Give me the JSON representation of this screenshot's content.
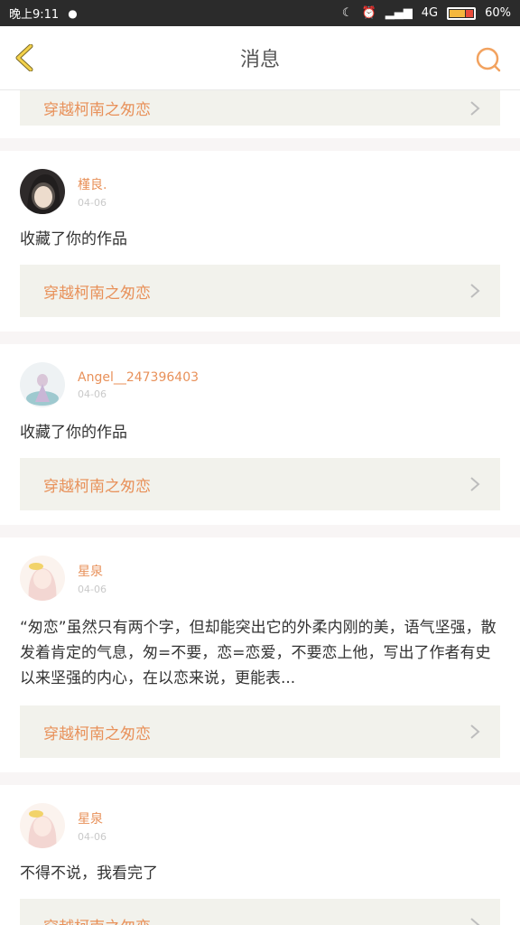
{
  "status": {
    "time": "晚上9:11",
    "network": "4G",
    "battery": "60%"
  },
  "header": {
    "title": "消息"
  },
  "link_text": "穿越柯南之匆恋",
  "messages": [
    {
      "user": "槿良.",
      "date": "04-06",
      "text": "收藏了你的作品"
    },
    {
      "user": "Angel__247396403",
      "date": "04-06",
      "text": "收藏了你的作品"
    },
    {
      "user": "星泉",
      "date": "04-06",
      "text": "“匆恋”虽然只有两个字，但却能突出它的外柔内刚的美，语气坚强，散发着肯定的气息，匆=不要，恋=恋爱，不要恋上他，写出了作者有史以来坚强的内心，在以恋来说，更能表..."
    },
    {
      "user": "星泉",
      "date": "04-06",
      "text": "不得不说，我看完了"
    }
  ],
  "colors": {
    "accent": "#e8915a",
    "card_bg": "#f2f2ec",
    "divider_bg": "#f8f5f5"
  },
  "icons": {
    "back": "chevron-left-icon",
    "search": "search-icon",
    "link_arrow": "chevron-right-icon"
  }
}
